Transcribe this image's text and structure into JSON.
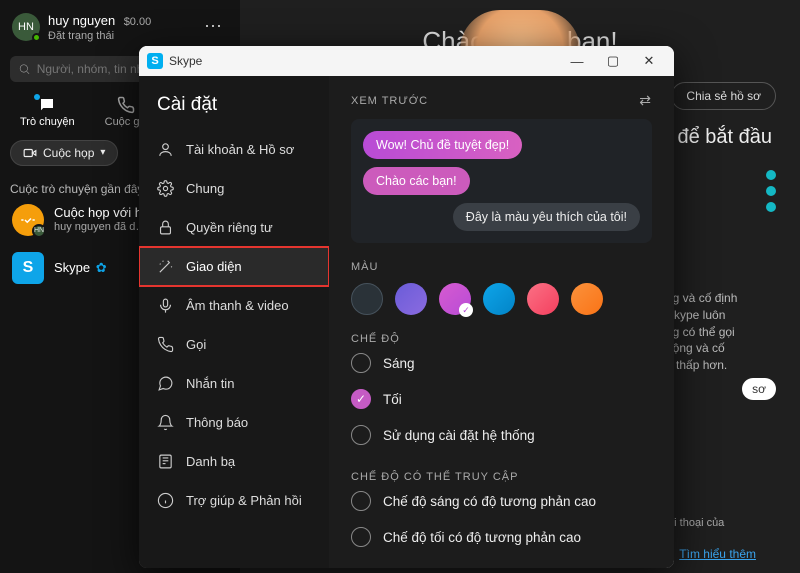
{
  "sidebar": {
    "avatar_initials": "HN",
    "user_name": "huy nguyen",
    "balance": "$0.00",
    "status_prompt": "Đặt trạng thái",
    "search_placeholder": "Người, nhóm, tin nhắn",
    "tabs": {
      "chats": "Trò chuyện",
      "calls": "Cuộc gọi"
    },
    "meet_button": "Cuộc họp",
    "recent_label": "Cuộc trò chuyện gần đây",
    "conversations": [
      {
        "title": "Cuộc họp với h…",
        "sub": "huy nguyen đã d…"
      },
      {
        "title": "Skype",
        "sub": ""
      }
    ]
  },
  "main": {
    "greeting": "Chào mừng bạn!",
    "share_profile": "Chia sẻ hồ sơ",
    "start_text": "để bắt đầu",
    "info": "ng và cố định\n Skype luôn\nng có thể gọi\nđộng và cố\nẻ thấp hơn.",
    "pill": "sơ",
    "history": "sử hội thoại của",
    "learn_more": "Tìm hiểu thêm"
  },
  "modal": {
    "title": "Skype",
    "heading": "Cài đặt",
    "nav": [
      "Tài khoản & Hồ sơ",
      "Chung",
      "Quyền riêng tư",
      "Giao diện",
      "Âm thanh & video",
      "Gọi",
      "Nhắn tin",
      "Thông báo",
      "Danh bạ",
      "Trợ giúp & Phản hồi"
    ],
    "preview_label": "XEM TRƯỚC",
    "bubble1": "Wow! Chủ đề tuyệt đẹp!",
    "bubble2": "Chào các bạn!",
    "bubble3": "Đây là màu yêu thích của tôi!",
    "color_label": "MÀU",
    "colors": [
      "default",
      "purple",
      "pink",
      "blue",
      "coral",
      "orange"
    ],
    "selected_color": "pink",
    "mode_label": "CHẾ ĐỘ",
    "modes": [
      "Sáng",
      "Tối",
      "Sử dụng cài đặt hệ thống"
    ],
    "selected_mode": "Tối",
    "hc_label": "CHẾ ĐỘ CÓ THỂ TRUY CẬP",
    "hc_modes": [
      "Chế độ sáng có độ tương phản cao",
      "Chế độ tối có độ tương phản cao"
    ]
  }
}
